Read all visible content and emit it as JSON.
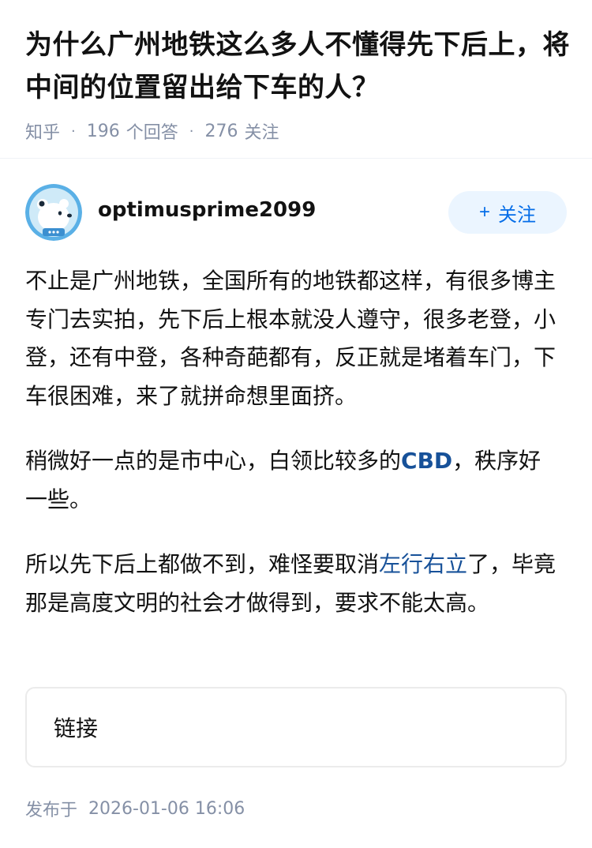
{
  "question": {
    "title": "为什么广州地铁这么多人不懂得先下后上，将中间的位置留出给下车的人？",
    "source": "知乎",
    "answer_count": "196",
    "answer_label": "个回答",
    "follow_count": "276",
    "follow_label": "关注"
  },
  "author": {
    "name": "optimusprime2099",
    "avatar_icon": "avatar-polar-bear-icon",
    "follow_plus": "+",
    "follow_button": "关注"
  },
  "answer": {
    "p1": "不止是广州地铁，全国所有的地铁都这样，有很多博主专门去实拍，先下后上根本就没人遵守，很多老登，小登，还有中登，各种奇葩都有，反正就是堵着车门，下车很困难，来了就拼命想里面挤。",
    "p2_before": "稍微好一点的是市中心，白领比较多的",
    "p2_link": "CBD",
    "p2_after": "，秩序好一些。",
    "p3_before": "所以先下后上都做不到，难怪要取消",
    "p3_link": "左行右立",
    "p3_after": "了，毕竟那是高度文明的社会才做得到，要求不能太高。"
  },
  "link_card": {
    "label": "链接"
  },
  "publish": {
    "label": "发布于",
    "time": "2026-01-06 16:06"
  },
  "colors": {
    "accent": "#056de8",
    "link": "#175199",
    "meta": "#8590a6",
    "follow_bg": "#ebf5ff"
  }
}
